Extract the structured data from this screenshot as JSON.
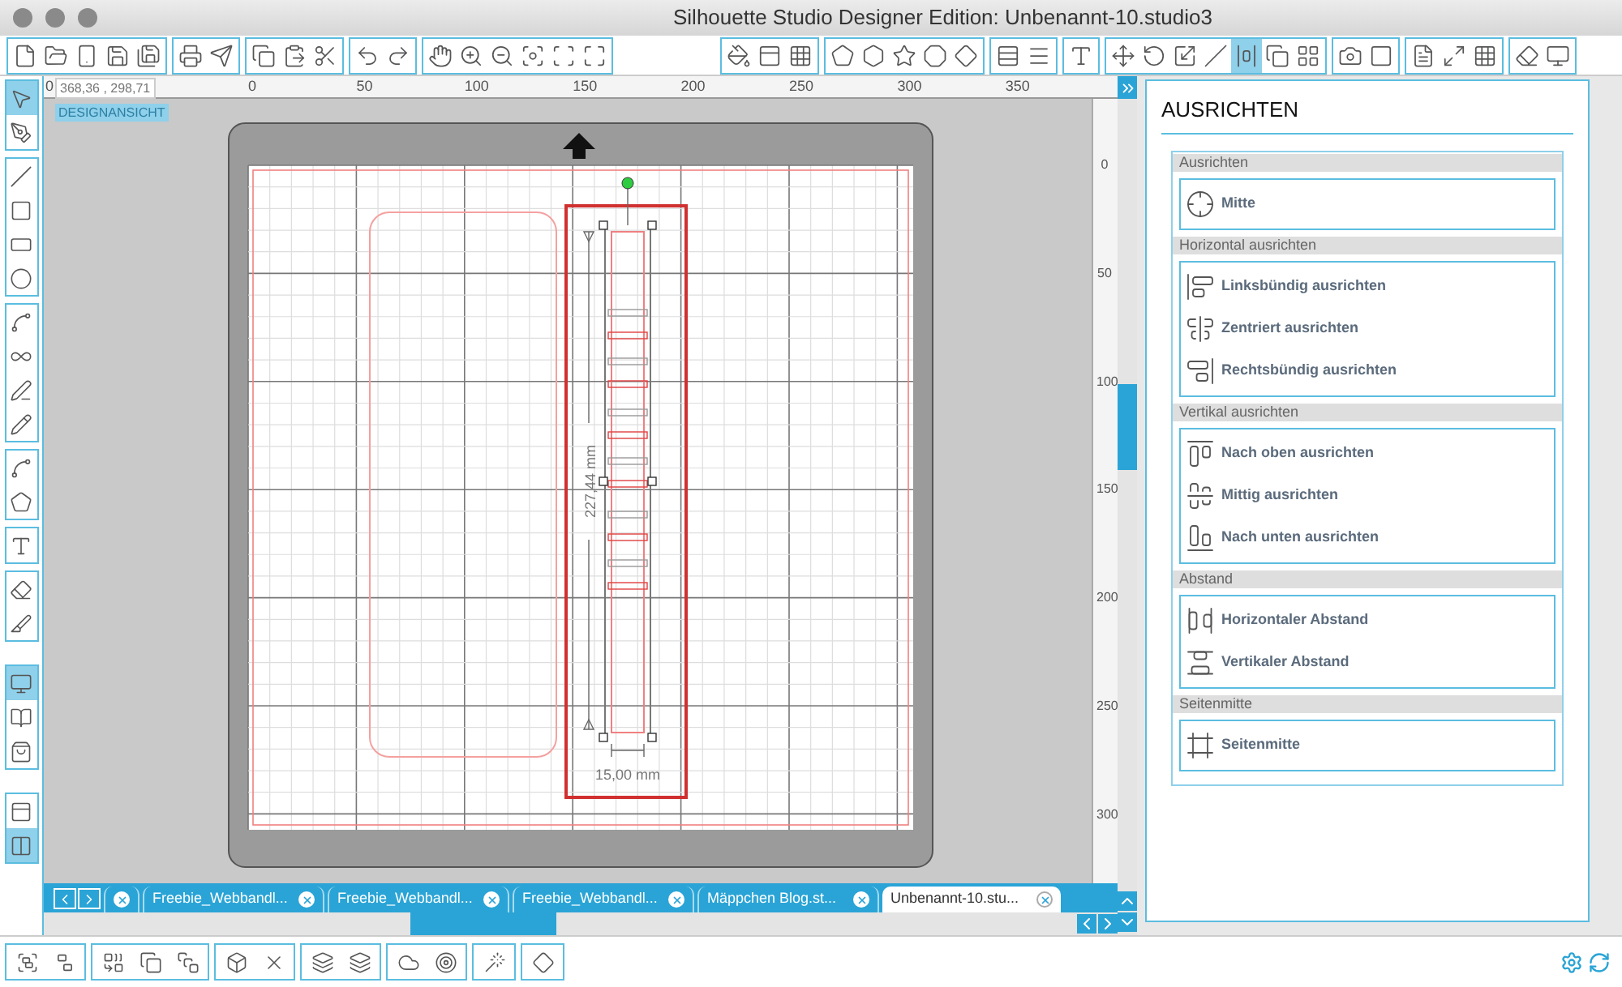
{
  "window": {
    "title": "Silhouette Studio Designer Edition: Unbenannt-10.studio3"
  },
  "top_toolbar": [
    [
      {
        "selected": false
      },
      {
        "selected": false
      },
      {
        "selected": false
      },
      {
        "selected": false
      },
      {
        "selected": false
      }
    ],
    [
      {
        "selected": false
      },
      {
        "selected": false
      }
    ],
    [
      {
        "selected": false
      },
      {
        "selected": false
      },
      {
        "selected": false
      }
    ],
    [
      {
        "selected": false
      },
      {
        "selected": false
      }
    ],
    [
      {
        "selected": false
      },
      {
        "selected": false
      },
      {
        "selected": false
      },
      {
        "selected": false
      },
      {
        "selected": false
      },
      {
        "selected": false
      }
    ],
    [
      {
        "selected": false
      },
      {
        "selected": false
      },
      {
        "selected": false
      }
    ],
    [
      {
        "selected": false
      },
      {
        "selected": false
      },
      {
        "selected": false
      },
      {
        "selected": false
      },
      {
        "selected": false
      }
    ],
    [
      {
        "selected": false
      },
      {
        "selected": false
      }
    ],
    [
      {
        "selected": false
      }
    ],
    [
      {
        "selected": false
      },
      {
        "selected": false
      },
      {
        "selected": false
      },
      {
        "selected": false
      },
      {
        "selected": true
      },
      {
        "selected": false
      },
      {
        "selected": false
      }
    ],
    [
      {
        "selected": false
      },
      {
        "selected": false
      }
    ],
    [
      {
        "selected": false
      },
      {
        "selected": false
      },
      {
        "selected": false
      }
    ],
    [
      {
        "selected": false
      },
      {
        "selected": false
      }
    ]
  ],
  "tools": [
    [
      {
        "selected": true
      },
      {
        "selected": false
      }
    ],
    [
      {
        "selected": false
      },
      {
        "selected": false
      },
      {
        "selected": false
      },
      {
        "selected": false
      }
    ],
    [
      {
        "selected": false
      },
      {
        "selected": false
      },
      {
        "selected": false
      },
      {
        "selected": false
      }
    ],
    [
      {
        "selected": false
      },
      {
        "selected": false
      }
    ],
    [
      {
        "selected": false
      }
    ],
    [
      {
        "selected": false
      },
      {
        "selected": false
      }
    ],
    [
      {
        "selected": true
      },
      {
        "selected": false
      },
      {
        "selected": false
      }
    ],
    [
      {
        "selected": false
      },
      {
        "selected": true
      }
    ]
  ],
  "ruler": {
    "origin": "0",
    "coordinates": "368,36 , 298,71",
    "top_labels": [
      "0",
      "50",
      "100",
      "150",
      "200",
      "250",
      "300",
      "350"
    ],
    "side_labels": [
      "0",
      "50",
      "100",
      "150",
      "200",
      "250",
      "300"
    ]
  },
  "view_label": "DESIGNANSICHT",
  "canvas": {
    "height_label": "227,44 mm",
    "width_label": "15,00 mm"
  },
  "tabs": [
    {
      "selected": false
    },
    {
      "label": "Freebie_Webbandl...",
      "selected": false
    },
    {
      "label": "Freebie_Webbandl...",
      "selected": false
    },
    {
      "label": "Freebie_Webbandl...",
      "selected": false
    },
    {
      "label": "Mäppchen Blog.st...",
      "selected": false
    },
    {
      "label": "Unbenannt-10.stu...",
      "selected": true
    }
  ],
  "panel": {
    "title": "AUSRICHTEN",
    "sections": [
      {
        "heading": "Ausrichten",
        "items": [
          "Mitte"
        ]
      },
      {
        "heading": "Horizontal ausrichten",
        "items": [
          "Linksbündig ausrichten",
          "Zentriert ausrichten",
          "Rechtsbündig ausrichten"
        ]
      },
      {
        "heading": "Vertikal ausrichten",
        "items": [
          "Nach oben ausrichten",
          "Mittig ausrichten",
          "Nach unten ausrichten"
        ]
      },
      {
        "heading": "Abstand",
        "items": [
          "Horizontaler Abstand",
          "Vertikaler Abstand"
        ]
      },
      {
        "heading": "Seitenmitte",
        "items": [
          "Seitenmitte"
        ]
      }
    ]
  }
}
